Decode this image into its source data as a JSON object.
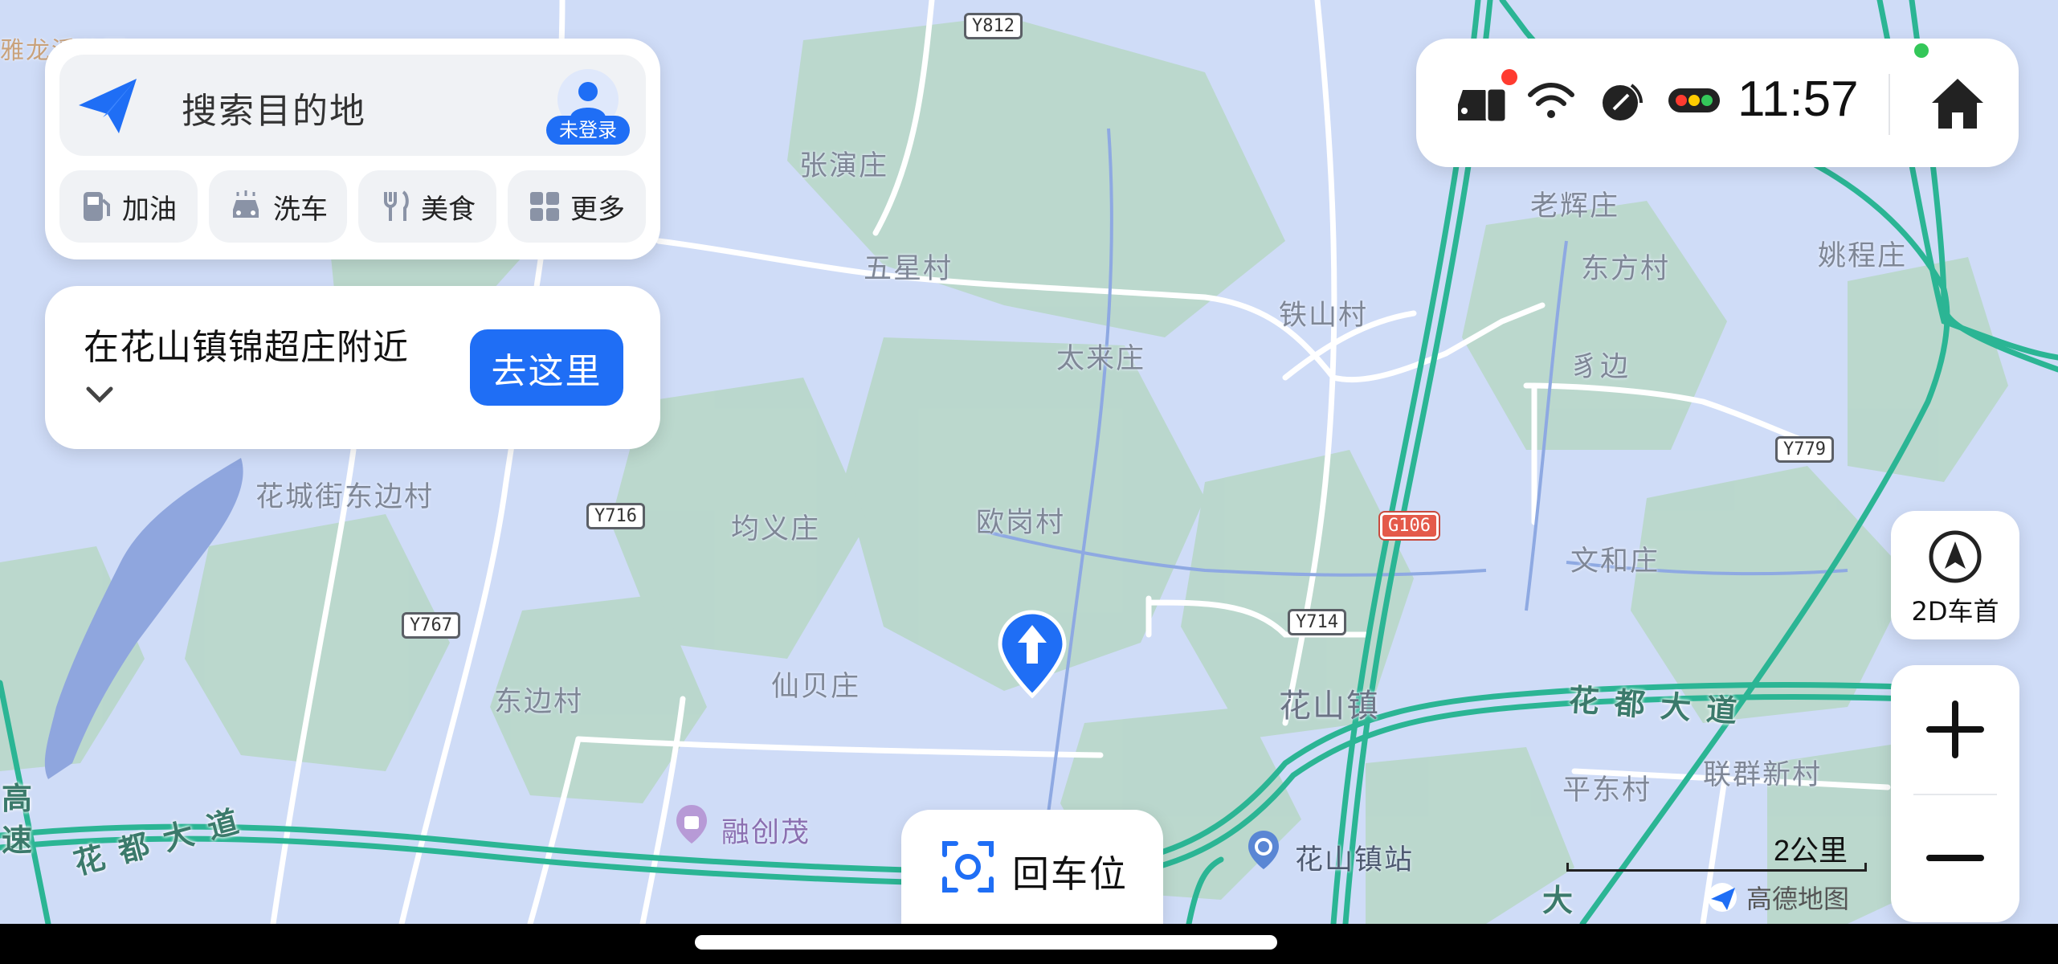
{
  "search": {
    "placeholder": "搜索目的地",
    "avatar_label": "未登录"
  },
  "quick_actions": [
    {
      "label": "加油",
      "icon": "gas-station-icon"
    },
    {
      "label": "洗车",
      "icon": "car-wash-icon"
    },
    {
      "label": "美食",
      "icon": "fork-knife-icon"
    },
    {
      "label": "更多",
      "icon": "grid-icon"
    }
  ],
  "location_card": {
    "text": "在花山镇锦超庄附近",
    "go_label": "去这里"
  },
  "status_bar": {
    "time": "11:57",
    "icons": [
      "car-phone-icon",
      "wifi-icon",
      "signal-icon",
      "traffic-light-icon",
      "home-icon"
    ],
    "dot_color": "#ff3b30",
    "indicator_color": "#34c759"
  },
  "map_controls": {
    "view_mode_label": "2D车首",
    "zoom_in": "+",
    "zoom_out": "−",
    "recenter_label": "回车位",
    "scale_label": "2公里",
    "brand": "高德地图"
  },
  "map_places": [
    "张演庄",
    "五星村",
    "铁山村",
    "太来庄",
    "老辉庄",
    "东方村",
    "姚程庄",
    "豸边",
    "花城街东边村",
    "均义庄",
    "欧岗村",
    "文和庄",
    "仙贝庄",
    "东边村",
    "花山镇",
    "平东村",
    "联群新村",
    "融创茂",
    "花山镇站",
    "雅龙溪公园"
  ],
  "road_labels": [
    "Y812",
    "Y716",
    "Y767",
    "Y714",
    "Y779",
    "G106"
  ],
  "road_names": [
    "花 都 大 道",
    "花 都 大 道",
    "高 速",
    "大"
  ],
  "colors": {
    "accent": "#1f6ef5",
    "map_bg": "#cfdcf7",
    "green_area": "#b9d9c7",
    "highway": "#2bb594"
  }
}
